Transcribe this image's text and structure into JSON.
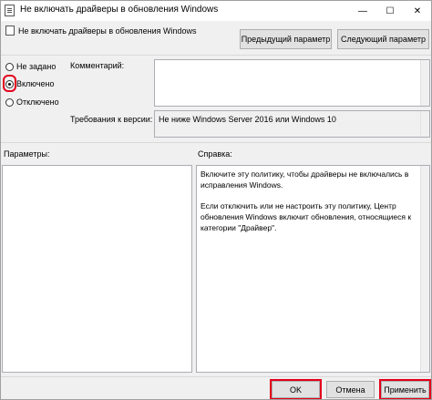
{
  "window": {
    "title": "Не включать драйверы в обновления Windows",
    "minimize_glyph": "—",
    "maximize_glyph": "☐",
    "close_glyph": "✕"
  },
  "header": {
    "policy_title": "Не включать драйверы в обновления Windows",
    "prev_button": "Предыдущий параметр",
    "next_button": "Следующий параметр"
  },
  "state": {
    "options": [
      {
        "label": "Не задано",
        "checked": false
      },
      {
        "label": "Включено",
        "checked": true
      },
      {
        "label": "Отключено",
        "checked": false
      }
    ],
    "highlight_color": "#e3001b"
  },
  "comment": {
    "label": "Комментарий:",
    "value": ""
  },
  "supported": {
    "label": "Требования к версии:",
    "value": "Не ниже Windows Server 2016 или Windows 10"
  },
  "panels": {
    "options_label": "Параметры:",
    "help_label": "Справка:",
    "help_paragraphs": [
      "Включите эту политику, чтобы драйверы не включались в исправления Windows.",
      "Если отключить или не настроить эту политику, Центр обновления Windows включит обновления, относящиеся к категории \"Драйвер\"."
    ]
  },
  "footer": {
    "ok": "OK",
    "cancel": "Отмена",
    "apply": "Применить"
  }
}
